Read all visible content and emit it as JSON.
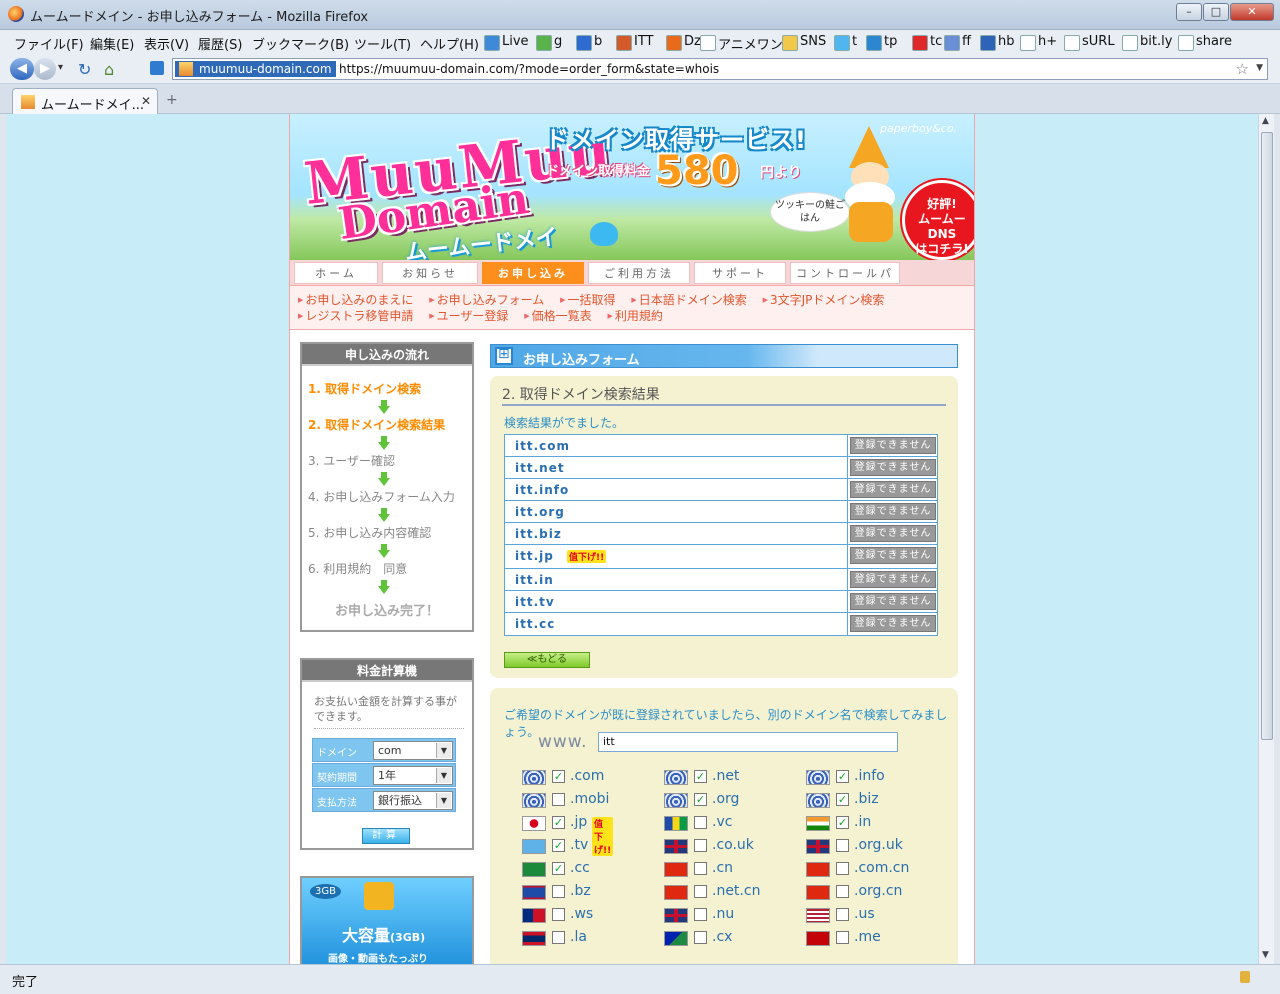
{
  "window": {
    "title": "ムームードメイン - お申し込みフォーム - Mozilla Firefox",
    "min": "–",
    "max": "□",
    "close": "✕"
  },
  "menu": [
    "ファイル(F)",
    "編集(E)",
    "表示(V)",
    "履歴(S)",
    "ブックマーク(B)",
    "ツール(T)",
    "ヘルプ(H)"
  ],
  "bookmarks": [
    {
      "label": "Live",
      "color": "#3f8ad8"
    },
    {
      "label": "g",
      "color": "#5ab34a"
    },
    {
      "label": "b",
      "color": "#2d6bd1"
    },
    {
      "label": "ITT",
      "color": "#d45a2a"
    },
    {
      "label": "Dz",
      "color": "#e86a1a"
    },
    {
      "label": "アニメワン",
      "color": "#ffffff"
    },
    {
      "label": "SNS",
      "color": "#f2c84b"
    },
    {
      "label": "t",
      "color": "#4fb6ef"
    },
    {
      "label": "tp",
      "color": "#2d86d0"
    },
    {
      "label": "tc",
      "color": "#e0282a"
    },
    {
      "label": "ff",
      "color": "#6b8fd6"
    },
    {
      "label": "hb",
      "color": "#2e63b8"
    },
    {
      "label": "h+",
      "color": "#ffffff"
    },
    {
      "label": "sURL",
      "color": "#ffffff"
    },
    {
      "label": "bit.ly",
      "color": "#ffffff"
    },
    {
      "label": "share",
      "color": "#ffffff"
    }
  ],
  "nav": {
    "back": "◀",
    "forward": "▶",
    "dropdown": "▾",
    "reload": "↻",
    "home": "⌂",
    "site_badge": "muumuu-domain.com",
    "url": "https://muumuu-domain.com/?mode=order_form&state=whois",
    "star": "☆",
    "url_drop": "▼"
  },
  "tabs": {
    "active_label": "ムームードメイ...",
    "close": "✕",
    "new_tab": "+"
  },
  "status_bar": {
    "text": "完了"
  },
  "header": {
    "logo_line1": "MuuMuu",
    "logo_line2": "Domain",
    "logo_kana": "ムームードメイン",
    "service_title": "ドメイン取得サービス!",
    "price_label": "ドメイン取得料金",
    "price": "580",
    "price_suffix": "円より",
    "paperboy": "paperboy&co.",
    "bubble": "ツッキーの鮭ごはん",
    "dns_badge_line1": "好評!",
    "dns_badge_line2": "ムームーDNS",
    "dns_badge_line3": "はコチラ!"
  },
  "gnav": [
    {
      "label": "ホーム",
      "active": false
    },
    {
      "label": "お知らせ",
      "active": false
    },
    {
      "label": "お申し込み",
      "active": true
    },
    {
      "label": "ご利用方法",
      "active": false
    },
    {
      "label": "サポート",
      "active": false
    },
    {
      "label": "コントロールパネル",
      "active": false
    }
  ],
  "sublinks": [
    "お申し込みのまえに",
    "お申し込みフォーム",
    "一括取得",
    "日本語ドメイン検索",
    "3文字JPドメイン検索",
    "レジストラ移管申請",
    "ユーザー登録",
    "価格一覧表",
    "利用規約"
  ],
  "flow": {
    "title": "申し込みの流れ",
    "steps": [
      {
        "label": "1. 取得ドメイン検索",
        "done": true
      },
      {
        "label": "2. 取得ドメイン検索結果",
        "done": true
      },
      {
        "label": "3. ユーザー確認",
        "done": false
      },
      {
        "label": "4. お申し込みフォーム入力",
        "done": false
      },
      {
        "label": "5. お申し込み内容確認",
        "done": false
      },
      {
        "label": "6. 利用規約　同意",
        "done": false
      }
    ],
    "complete": "お申し込み完了！"
  },
  "calculator": {
    "title": "料金計算機",
    "description": "お支払い金額を計算する事ができます。",
    "rows": [
      {
        "label": "ドメイン",
        "value": "com"
      },
      {
        "label": "契約期間",
        "value": "1年"
      },
      {
        "label": "支払方法",
        "value": "銀行振込"
      }
    ],
    "button": "計算"
  },
  "ad": {
    "capacity": "3GB",
    "headline": "大容量",
    "headline_small": "(3GB)",
    "subline": "画像・動画もたっぷり"
  },
  "form": {
    "title": "お申し込みフォーム",
    "results_title": "2. 取得ドメイン検索結果",
    "results_message": "検索結果がでました。",
    "status_label": "登録できません",
    "sale_tag": "值下げ!!",
    "results": [
      {
        "domain": "itt.com",
        "sale": false
      },
      {
        "domain": "itt.net",
        "sale": false
      },
      {
        "domain": "itt.info",
        "sale": false
      },
      {
        "domain": "itt.org",
        "sale": false
      },
      {
        "domain": "itt.biz",
        "sale": false
      },
      {
        "domain": "itt.jp",
        "sale": true
      },
      {
        "domain": "itt.in",
        "sale": false
      },
      {
        "domain": "itt.tv",
        "sale": false
      },
      {
        "domain": "itt.cc",
        "sale": false
      }
    ],
    "back_button": "≪もどる",
    "search_message": "ご希望のドメインが既に登録されていましたら、別のドメイン名で検索してみましょう。",
    "www_label": "www.",
    "search_value": "itt"
  },
  "tlds": [
    {
      "name": ".com",
      "checked": true,
      "flag": "globe"
    },
    {
      "name": ".net",
      "checked": true,
      "flag": "globe"
    },
    {
      "name": ".info",
      "checked": true,
      "flag": "globe"
    },
    {
      "name": ".mobi",
      "checked": false,
      "flag": "globe"
    },
    {
      "name": ".org",
      "checked": true,
      "flag": "globe"
    },
    {
      "name": ".biz",
      "checked": true,
      "flag": "globe"
    },
    {
      "name": ".jp",
      "checked": true,
      "flag": "jp",
      "sale": true
    },
    {
      "name": ".vc",
      "checked": false,
      "flag": "vc"
    },
    {
      "name": ".in",
      "checked": true,
      "flag": "in"
    },
    {
      "name": ".tv",
      "checked": true,
      "flag": "tv"
    },
    {
      "name": ".co.uk",
      "checked": false,
      "flag": "uk"
    },
    {
      "name": ".org.uk",
      "checked": false,
      "flag": "uk"
    },
    {
      "name": ".cc",
      "checked": true,
      "flag": "cc"
    },
    {
      "name": ".cn",
      "checked": false,
      "flag": "cn"
    },
    {
      "name": ".com.cn",
      "checked": false,
      "flag": "cn"
    },
    {
      "name": ".bz",
      "checked": false,
      "flag": "bz"
    },
    {
      "name": ".net.cn",
      "checked": false,
      "flag": "cn"
    },
    {
      "name": ".org.cn",
      "checked": false,
      "flag": "cn"
    },
    {
      "name": ".ws",
      "checked": false,
      "flag": "ws"
    },
    {
      "name": ".nu",
      "checked": false,
      "flag": "uk"
    },
    {
      "name": ".us",
      "checked": false,
      "flag": "us"
    },
    {
      "name": ".la",
      "checked": false,
      "flag": "la"
    },
    {
      "name": ".cx",
      "checked": false,
      "flag": "cx"
    },
    {
      "name": ".me",
      "checked": false,
      "flag": "me"
    }
  ]
}
